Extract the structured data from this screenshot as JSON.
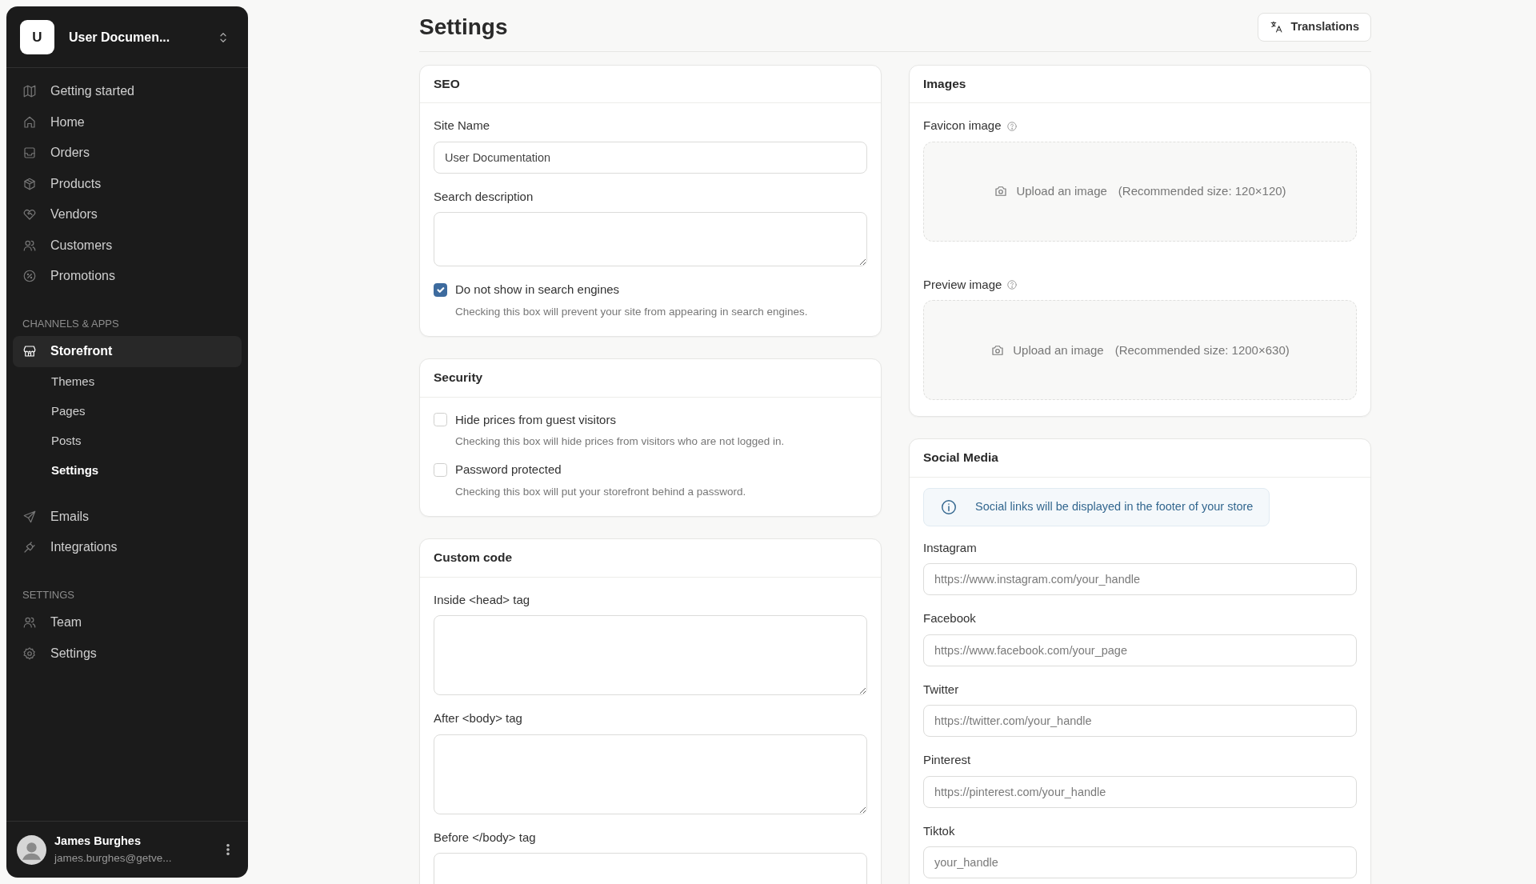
{
  "sidebar": {
    "workspace": {
      "initial": "U",
      "name": "User Documen..."
    },
    "sections": [
      {
        "items": [
          {
            "label": "Getting started",
            "selected": false
          },
          {
            "label": "Home",
            "selected": false
          },
          {
            "label": "Orders",
            "selected": false
          },
          {
            "label": "Products",
            "selected": false
          },
          {
            "label": "Vendors",
            "selected": false
          },
          {
            "label": "Customers",
            "selected": false
          },
          {
            "label": "Promotions",
            "selected": false
          }
        ]
      },
      {
        "heading": "CHANNELS & APPS",
        "items": [
          {
            "label": "Storefront",
            "selected": true,
            "expanded": true,
            "children": [
              {
                "label": "Themes",
                "selected": false
              },
              {
                "label": "Pages",
                "selected": false
              },
              {
                "label": "Posts",
                "selected": false
              },
              {
                "label": "Settings",
                "selected": true
              }
            ]
          },
          {
            "label": "Emails",
            "selected": false
          },
          {
            "label": "Integrations",
            "selected": false
          }
        ]
      },
      {
        "heading": "SETTINGS",
        "items": [
          {
            "label": "Team",
            "selected": false
          },
          {
            "label": "Settings",
            "selected": false
          }
        ]
      }
    ],
    "user": {
      "name": "James Burghes",
      "email": "james.burghes@getve..."
    }
  },
  "page": {
    "title": "Settings",
    "actions": [
      {
        "label": "Translations"
      }
    ]
  },
  "columns": [
    [
      {
        "title": "SEO",
        "fields": [
          {
            "kind": "input",
            "label": "Site Name",
            "value": "User Documentation"
          },
          {
            "kind": "textarea",
            "label": "Search description"
          },
          {
            "kind": "checkbox",
            "label": "Do not show in search engines",
            "checked": true,
            "help": "Checking this box will prevent your site from appearing in search engines."
          }
        ]
      },
      {
        "title": "Security",
        "fields": [
          {
            "kind": "checkbox",
            "label": "Hide prices from guest visitors",
            "checked": false,
            "help": "Checking this box will hide prices from visitors who are not logged in."
          },
          {
            "kind": "checkbox",
            "label": "Password protected",
            "checked": false,
            "help": "Checking this box will put your storefront behind a password."
          }
        ]
      },
      {
        "title": "Custom code",
        "fields": [
          {
            "kind": "textarea",
            "label": "Inside <head> tag"
          },
          {
            "kind": "textarea",
            "label": "After <body> tag"
          },
          {
            "kind": "textarea",
            "label": "Before </body> tag"
          }
        ]
      }
    ],
    [
      {
        "title": "Images",
        "fields": [
          {
            "kind": "upload",
            "label": "Favicon image",
            "action": "Upload an image",
            "hint": "(Recommended size: 120×120)"
          },
          {
            "kind": "upload",
            "label": "Preview image",
            "action": "Upload an image",
            "hint": "(Recommended size: 1200×630)"
          }
        ]
      },
      {
        "title": "Social Media",
        "fields": [
          {
            "kind": "notice",
            "text": "Social links will be displayed in the footer of your store"
          },
          {
            "kind": "input",
            "label": "Instagram",
            "placeholder": "https://www.instagram.com/your_handle"
          },
          {
            "kind": "input",
            "label": "Facebook",
            "placeholder": "https://www.facebook.com/your_page"
          },
          {
            "kind": "input",
            "label": "Twitter",
            "placeholder": "https://twitter.com/your_handle"
          },
          {
            "kind": "input",
            "label": "Pinterest",
            "placeholder": "https://pinterest.com/your_handle"
          },
          {
            "kind": "input",
            "label": "Tiktok",
            "placeholder": "your_handle"
          }
        ]
      }
    ]
  ]
}
